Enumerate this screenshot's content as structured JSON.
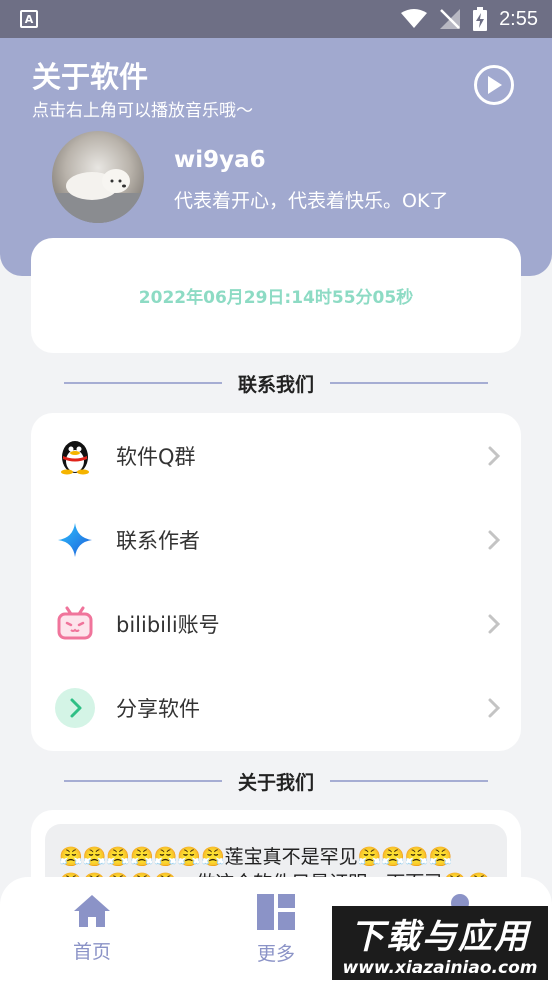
{
  "status_bar": {
    "time": "2:55"
  },
  "header": {
    "title": "关于软件",
    "subtitle": "点击右上角可以播放音乐哦～",
    "username": "wi9ya6",
    "signature": "代表着开心，代表着快乐。OK了"
  },
  "time_card": {
    "text": "2022年06月29日:14时55分05秒"
  },
  "contact_section": {
    "heading": "联系我们",
    "items": [
      {
        "label": "软件Q群",
        "icon": "qq-penguin-icon"
      },
      {
        "label": "联系作者",
        "icon": "sparkle-star-icon"
      },
      {
        "label": "bilibili账号",
        "icon": "bilibili-tv-icon"
      },
      {
        "label": "分享软件",
        "icon": "share-arrow-icon"
      }
    ]
  },
  "about_section": {
    "heading": "关于我们",
    "text_line1": "😤😤😤😤😤😤😤莲宝真不是罕见😤😤😤😤",
    "text_line2": "😤😤😤😤😤，做这个软件只是证明一下而已😤😤"
  },
  "bottom_nav": {
    "items": [
      {
        "label": "首页",
        "icon": "home-icon"
      },
      {
        "label": "更多",
        "icon": "dashboard-icon"
      },
      {
        "label": "",
        "icon": "user-icon"
      }
    ]
  },
  "watermark": {
    "main": "下载与应用",
    "url": "www.xiazainiao.com"
  },
  "colors": {
    "header_bg": "#a1a9cf",
    "accent": "#8b93c7",
    "time_text": "#8ddbc4"
  }
}
